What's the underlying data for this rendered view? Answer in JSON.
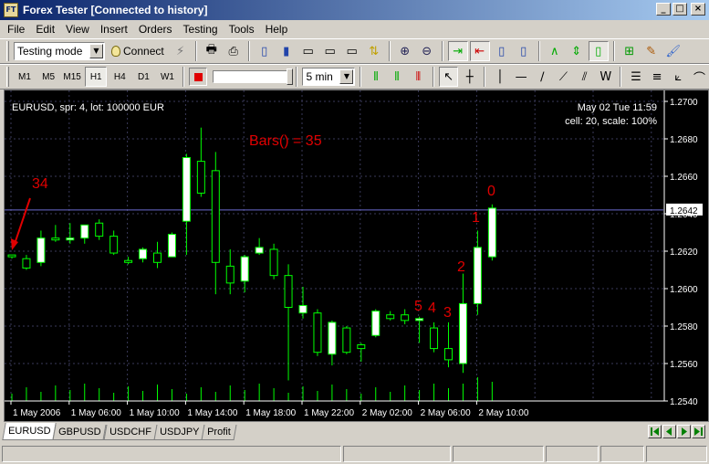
{
  "window": {
    "title": "Forex Tester [Connected to history]",
    "app_icon": "FT"
  },
  "window_buttons": {
    "minimize": "_",
    "maximize": "□",
    "close": "×"
  },
  "menu": [
    "File",
    "Edit",
    "View",
    "Insert",
    "Orders",
    "Testing",
    "Tools",
    "Help"
  ],
  "toolbar1": {
    "mode_select": "Testing mode",
    "connect_label": "Connect"
  },
  "toolbar2": {
    "timeframes": [
      "M1",
      "M5",
      "M15",
      "H1",
      "H4",
      "D1",
      "W1"
    ],
    "active_timeframe": "H1",
    "speed_fraction": 1.0,
    "interval_select": "5 min"
  },
  "chart": {
    "info_left": "EURUSD, spr: 4, lot: 100000 EUR",
    "info_right_line1": "May 02 Tue 11:59",
    "info_right_line2": "cell: 20, scale: 100%",
    "bars_annotation": "Bars() = 35",
    "current_price": "1.2642",
    "price_labels": [
      "1.2700",
      "1.2680",
      "1.2660",
      "1.2640",
      "1.2620",
      "1.2600",
      "1.2580",
      "1.2560",
      "1.2540"
    ],
    "time_labels": [
      "1 May 2006",
      "1 May 06:00",
      "1 May 10:00",
      "1 May 14:00",
      "1 May 18:00",
      "1 May 22:00",
      "2 May 02:00",
      "2 May 06:00",
      "2 May 10:00"
    ],
    "index_labels": [
      "34",
      "5",
      "4",
      "3",
      "2",
      "1",
      "0"
    ],
    "colors": {
      "bull": "#ffffff",
      "bear": "#000000",
      "wick": "#00ff00",
      "grid": "#3a3a5a",
      "annotation": "#e00000",
      "price_line": "#6b6bd0"
    },
    "candles": [
      {
        "o": 1.2618,
        "h": 1.2618,
        "l": 1.2616,
        "c": 1.2617
      },
      {
        "o": 1.2616,
        "h": 1.2618,
        "l": 1.261,
        "c": 1.2611
      },
      {
        "o": 1.2614,
        "h": 1.2631,
        "l": 1.2612,
        "c": 1.2627
      },
      {
        "o": 1.2627,
        "h": 1.2634,
        "l": 1.2625,
        "c": 1.2626
      },
      {
        "o": 1.2626,
        "h": 1.2635,
        "l": 1.2624,
        "c": 1.2627
      },
      {
        "o": 1.2627,
        "h": 1.2634,
        "l": 1.2624,
        "c": 1.2634
      },
      {
        "o": 1.2635,
        "h": 1.2637,
        "l": 1.2626,
        "c": 1.2628
      },
      {
        "o": 1.2628,
        "h": 1.2631,
        "l": 1.2618,
        "c": 1.2619
      },
      {
        "o": 1.2615,
        "h": 1.2617,
        "l": 1.2613,
        "c": 1.2614
      },
      {
        "o": 1.2616,
        "h": 1.2622,
        "l": 1.2614,
        "c": 1.2621
      },
      {
        "o": 1.2619,
        "h": 1.2625,
        "l": 1.2611,
        "c": 1.2614
      },
      {
        "o": 1.2617,
        "h": 1.263,
        "l": 1.2617,
        "c": 1.2629
      },
      {
        "o": 1.2636,
        "h": 1.2672,
        "l": 1.2618,
        "c": 1.267
      },
      {
        "o": 1.2668,
        "h": 1.2686,
        "l": 1.2649,
        "c": 1.2651
      },
      {
        "o": 1.2663,
        "h": 1.2673,
        "l": 1.2597,
        "c": 1.2614
      },
      {
        "o": 1.2612,
        "h": 1.2621,
        "l": 1.2597,
        "c": 1.2603
      },
      {
        "o": 1.2604,
        "h": 1.2618,
        "l": 1.2598,
        "c": 1.2617
      },
      {
        "o": 1.2619,
        "h": 1.2627,
        "l": 1.2618,
        "c": 1.2622
      },
      {
        "o": 1.2621,
        "h": 1.2624,
        "l": 1.2605,
        "c": 1.2607
      },
      {
        "o": 1.2607,
        "h": 1.2613,
        "l": 1.2551,
        "c": 1.259
      },
      {
        "o": 1.2587,
        "h": 1.2601,
        "l": 1.2584,
        "c": 1.2591
      },
      {
        "o": 1.2587,
        "h": 1.2589,
        "l": 1.2564,
        "c": 1.2566
      },
      {
        "o": 1.2565,
        "h": 1.2583,
        "l": 1.2559,
        "c": 1.2582
      },
      {
        "o": 1.2579,
        "h": 1.258,
        "l": 1.2565,
        "c": 1.2566
      },
      {
        "o": 1.257,
        "h": 1.2571,
        "l": 1.2561,
        "c": 1.2568
      },
      {
        "o": 1.2575,
        "h": 1.2589,
        "l": 1.2574,
        "c": 1.2588
      },
      {
        "o": 1.2586,
        "h": 1.2588,
        "l": 1.2583,
        "c": 1.2584
      },
      {
        "o": 1.2586,
        "h": 1.2589,
        "l": 1.2581,
        "c": 1.2583
      },
      {
        "o": 1.2583,
        "h": 1.2585,
        "l": 1.2571,
        "c": 1.2584
      },
      {
        "o": 1.2579,
        "h": 1.2582,
        "l": 1.2566,
        "c": 1.2568
      },
      {
        "o": 1.2568,
        "h": 1.2582,
        "l": 1.2558,
        "c": 1.2562
      },
      {
        "o": 1.256,
        "h": 1.2608,
        "l": 1.2555,
        "c": 1.2592
      },
      {
        "o": 1.2592,
        "h": 1.2631,
        "l": 1.2586,
        "c": 1.2622
      },
      {
        "o": 1.2617,
        "h": 1.2645,
        "l": 1.2615,
        "c": 1.2643
      }
    ]
  },
  "tabs": [
    "EURUSD",
    "GBPUSD",
    "USDCHF",
    "USDJPY",
    "Profit"
  ],
  "active_tab": "EURUSD"
}
